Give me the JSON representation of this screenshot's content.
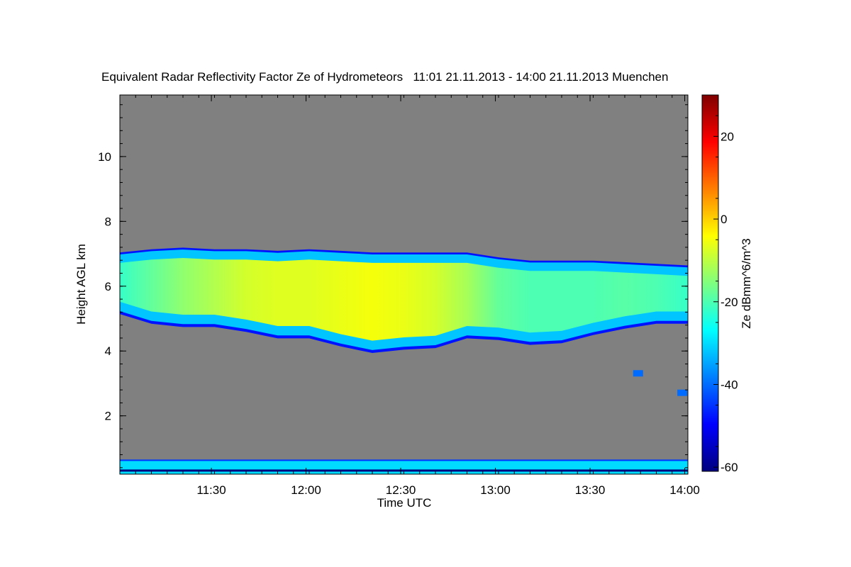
{
  "chart_data": {
    "type": "heatmap",
    "title": "Equivalent Radar Reflectivity Factor Ze of Hydrometeors   11:01 21.11.2013 - 14:00 21.11.2013 Muenchen",
    "xlabel": "Time UTC",
    "ylabel": "Height AGL km",
    "colorbar_label": "Ze dBmm^6/m^3",
    "x_ticks": [
      "11:30",
      "12:00",
      "12:30",
      "13:00",
      "13:30",
      "14:00"
    ],
    "x_tick_minutes": [
      29,
      59,
      89,
      119,
      149,
      179
    ],
    "x_range_minutes": [
      0,
      180
    ],
    "y_ticks": [
      "2",
      "4",
      "6",
      "8",
      "10"
    ],
    "y_tick_values": [
      2,
      4,
      6,
      8,
      10
    ],
    "ylim": [
      0.2,
      11.9
    ],
    "colorbar_ticks": [
      "20",
      "0",
      "-20",
      "-40",
      "-60"
    ],
    "colorbar_tick_values": [
      20,
      0,
      -20,
      -40,
      -60
    ],
    "colorbar_range": [
      -61,
      30
    ],
    "no_data_color": "#808080",
    "colorscale": [
      "#00007f",
      "#0000ff",
      "#007fff",
      "#00ffff",
      "#7fff7f",
      "#ffff00",
      "#ff7f00",
      "#ff0000",
      "#7f0000"
    ],
    "cloud_layer": {
      "time_minutes": [
        0,
        10,
        20,
        30,
        40,
        50,
        60,
        70,
        80,
        90,
        100,
        110,
        120,
        130,
        140,
        150,
        160,
        170,
        180
      ],
      "top_km": [
        7.0,
        7.1,
        7.15,
        7.1,
        7.1,
        7.05,
        7.1,
        7.05,
        7.0,
        7.0,
        7.0,
        7.0,
        6.85,
        6.75,
        6.75,
        6.75,
        6.7,
        6.65,
        6.6
      ],
      "base_km": [
        5.2,
        4.9,
        4.8,
        4.8,
        4.65,
        4.45,
        4.45,
        4.2,
        4.0,
        4.1,
        4.15,
        4.45,
        4.4,
        4.25,
        4.3,
        4.55,
        4.75,
        4.9,
        4.9
      ],
      "core_ze_dbz": [
        -22,
        -18,
        -14,
        -11,
        -8,
        -7,
        -7,
        -6,
        -5,
        -6,
        -8,
        -12,
        -18,
        -20,
        -20,
        -20,
        -19,
        -20,
        -22
      ]
    },
    "surface_layer": {
      "top_km": 0.65,
      "ze_dbz": -30
    },
    "isolated_echoes": [
      {
        "time_minutes": 164,
        "height_km": 3.3,
        "ze_dbz": -40
      },
      {
        "time_minutes": 178,
        "height_km": 2.7,
        "ze_dbz": -40
      }
    ]
  }
}
